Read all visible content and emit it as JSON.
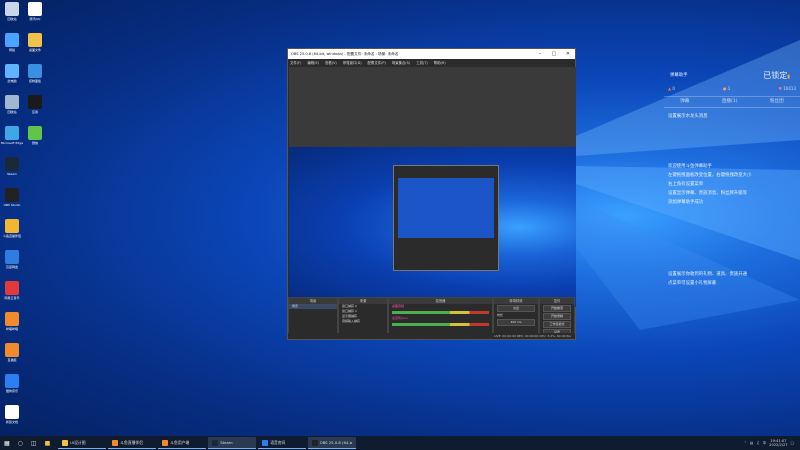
{
  "desktop": {
    "icons": [
      {
        "name": "recycle-bin-icon",
        "label": "回收站",
        "color": "#c9d6e8"
      },
      {
        "name": "qq-icon",
        "label": "腾讯QQ",
        "color": "#ffffff"
      },
      {
        "name": "network-icon",
        "label": "网络",
        "color": "#4aa3ff"
      },
      {
        "name": "folder-icon",
        "label": "桌面文件",
        "color": "#f0c24a"
      },
      {
        "name": "computer-icon",
        "label": "此电脑",
        "color": "#5fb4ff"
      },
      {
        "name": "monitor-icon",
        "label": "控制面板",
        "color": "#3a8fe0"
      },
      {
        "name": "trash-icon",
        "label": "回收站",
        "color": "#9fb7d1"
      },
      {
        "name": "app-dark-icon",
        "label": "应用",
        "color": "#1a1a1a"
      },
      {
        "name": "edge-icon",
        "label": "Microsoft Edge",
        "color": "#3fa7e8"
      },
      {
        "name": "wechat-icon",
        "label": "微信",
        "color": "#62c54a"
      },
      {
        "name": "steam-icon",
        "label": "Steam",
        "color": "#1b2838"
      },
      {
        "name": "obs-icon",
        "label": "OBS Studio",
        "color": "#222222"
      },
      {
        "name": "app-yellow-icon",
        "label": "斗鱼直播伴侣",
        "color": "#f2b632"
      },
      {
        "name": "app-blue-icon",
        "label": "百度网盘",
        "color": "#2f7de1"
      },
      {
        "name": "netease-icon",
        "label": "网易云音乐",
        "color": "#e23a3a"
      },
      {
        "name": "app-orange-icon",
        "label": "哔哩哔哩",
        "color": "#f08a2c"
      },
      {
        "name": "app-orange2-icon",
        "label": "直播姬",
        "color": "#f08a2c"
      },
      {
        "name": "kugou-icon",
        "label": "酷狗音乐",
        "color": "#2b7ff0"
      },
      {
        "name": "document-icon",
        "label": "新建文档",
        "color": "#ffffff"
      }
    ]
  },
  "obs_window": {
    "title": "OBS 25.0.8 (64-bit, windows) - 配置文件: 未命名 - 场景: 未命名",
    "menu": [
      "文件(F)",
      "编辑(E)",
      "查看(V)",
      "停靠窗口(D)",
      "配置文件(P)",
      "场景集合(S)",
      "工具(T)",
      "帮助(H)"
    ],
    "docks": {
      "scenes": {
        "title": "场景",
        "items": [
          "场景"
        ]
      },
      "sources": {
        "title": "来源",
        "items": [
          "窗口捕获 2",
          "窗口捕获 1",
          "显示器捕获",
          "音频输入捕获"
        ]
      },
      "mixer": {
        "title": "混音器",
        "items": [
          "桌面音频",
          "麦克风/Aux"
        ]
      },
      "transitions": {
        "title": "转场特效",
        "type": "淡出",
        "duration_label": "时长",
        "duration": "300 ms"
      },
      "controls": {
        "title": "控件",
        "buttons": [
          "开始推流",
          "开始录制",
          "工作室模式",
          "设置",
          "退出"
        ]
      }
    },
    "status": "LIVE: 00:00:00   REC: 00:00:00   CPU: 3.2%, 60.00 fps"
  },
  "panel": {
    "title": "弹幕助手",
    "lock_label": "已锁定",
    "stats": [
      "0",
      "1",
      "10413"
    ],
    "tabs": [
      "弹幕",
      "直播(1)",
      "粉丝团"
    ],
    "msg1": "设置展示水龙头消息",
    "guide": [
      "欢迎使用斗鱼弹幕助手",
      "左键拖拽面板改变位置，右键拖拽改变大小",
      "右上角有设置菜单",
      "设置显示弹幕、贵族消息，粉丝牌升级等",
      "添加弹幕助手成功"
    ],
    "tip": [
      "设置展示你收到的礼物、道具、贵族开通",
      "点菜单可设置小礼物屏蔽"
    ]
  },
  "taskbar": {
    "apps": [
      {
        "name": "taskbar-app-folder",
        "label": "UI设计图",
        "color": "#f0c24a"
      },
      {
        "name": "taskbar-app-live",
        "label": "斗鱼直播伴侣",
        "color": "#f08a2c"
      },
      {
        "name": "taskbar-app-user",
        "label": "斗鱼用户端",
        "color": "#f08a2c"
      },
      {
        "name": "taskbar-app-steam",
        "label": "Steam",
        "color": "#1b2838",
        "active": true
      },
      {
        "name": "taskbar-app-voice",
        "label": "语音房间",
        "color": "#2b7ff0"
      },
      {
        "name": "taskbar-app-obs",
        "label": "OBS 25.0.8 (64-bit)",
        "color": "#222222",
        "active": true
      }
    ],
    "time": "19:41:07",
    "date": "2022/2/27"
  }
}
